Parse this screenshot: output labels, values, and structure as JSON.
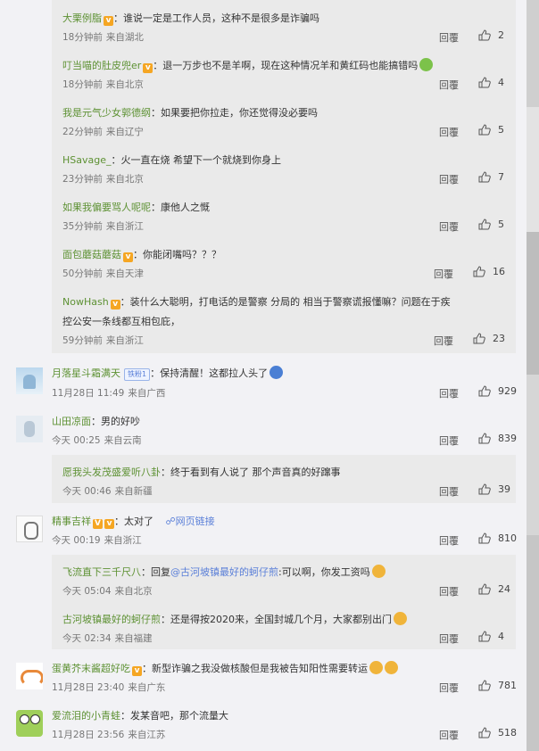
{
  "comments": [
    {
      "type": "sub",
      "user": "大栗例脂",
      "text": "：谁说一定是工作人员，这种不是很多是诈骗吗",
      "time": "18分钟前",
      "location": "来自湖北",
      "reply": "回覆",
      "likes": "2"
    },
    {
      "type": "sub",
      "user": "叮当喵的肚皮兜er",
      "text": "：退一万步也不是羊啊，现在这种情况羊和黄红码也能搞错吗",
      "time": "18分钟前",
      "location": "来自北京",
      "reply": "回覆",
      "likes": "4"
    },
    {
      "type": "sub",
      "user": "我是元气少女郭德纲",
      "text": "：如果要把你拉走，你还觉得没必要吗",
      "time": "22分钟前",
      "location": "来自辽宁",
      "reply": "回覆",
      "likes": "5"
    },
    {
      "type": "sub",
      "user": "HSavage_",
      "text": "：火一直在烧 希望下一个就烧到你身上",
      "time": "23分钟前",
      "location": "来自北京",
      "reply": "回覆",
      "likes": "7"
    },
    {
      "type": "sub",
      "user": "如果我偏要骂人呢呢",
      "text": "：康他人之慨",
      "time": "35分钟前",
      "location": "来自浙江",
      "reply": "回覆",
      "likes": "5"
    },
    {
      "type": "sub",
      "user": "面包蘑菇蘑菇",
      "text": "：你能闭嘴吗？？？",
      "time": "50分钟前",
      "location": "来自天津",
      "reply": "回覆",
      "likes": "16"
    },
    {
      "type": "sub",
      "user": "NowHash",
      "text": "：装什么大聪明，打电话的是警察 分局的 相当于警察谎报懂嘛？问题在于疾",
      "text2": "控公安一条线都互相包庇，",
      "time": "59分钟前",
      "location": "来自浙江",
      "reply": "回覆",
      "likes": "23"
    },
    {
      "type": "main",
      "user": "月落星斗霜满天",
      "fan_badge": "铁粉1",
      "text": "：保持清醒！这都拉人头了",
      "time": "11月28日 11:49",
      "location": "来自广西",
      "reply": "回覆",
      "likes": "929"
    },
    {
      "type": "main",
      "user": "山田凉面",
      "text": "：男的好吵",
      "time": "今天 00:25",
      "location": "来自云南",
      "reply": "回覆",
      "likes": "839"
    },
    {
      "type": "sub",
      "user": "愿我头发茂盛爱听八卦",
      "text": "：终于看到有人说了 那个声音真的好蹿事",
      "time": "今天 00:46",
      "location": "来自新疆",
      "reply": "回覆",
      "likes": "39"
    },
    {
      "type": "main",
      "user": "精事吉祥",
      "text": "：太对了",
      "link": "网页链接",
      "time": "今天 00:19",
      "location": "来自浙江",
      "reply": "回覆",
      "likes": "810"
    },
    {
      "type": "sub",
      "user": "飞流直下三千尺八",
      "text": "：回复",
      "mention": "@古河坡镇最好的蚵仔煎",
      "text_after": ":可以啊，你发工资吗",
      "time": "今天 05:04",
      "location": "来自北京",
      "reply": "回覆",
      "likes": "24"
    },
    {
      "type": "sub",
      "user": "古河坡镇最好的蚵仔煎",
      "text": "：还是得按2020来，全国封城几个月，大家都别出门",
      "time": "今天 02:34",
      "location": "来自福建",
      "reply": "回覆",
      "likes": "4"
    },
    {
      "type": "main",
      "user": "蛋黄芥末酱超好吃",
      "text": "：新型诈骗之我没做核酸但是我被告知阳性需要转运",
      "time": "11月28日 23:40",
      "location": "来自广东",
      "reply": "回覆",
      "likes": "781"
    },
    {
      "type": "main",
      "user": "爱流泪的小青蛙",
      "text": "：发某音吧，那个流量大",
      "time": "11月28日 23:56",
      "location": "来自江苏",
      "reply": "回覆",
      "likes": "518"
    }
  ],
  "colors": {
    "username": "#5d9133",
    "link": "#5a7fd8",
    "subBg": "#eaeaea",
    "pageBg": "#f2f2f5"
  }
}
